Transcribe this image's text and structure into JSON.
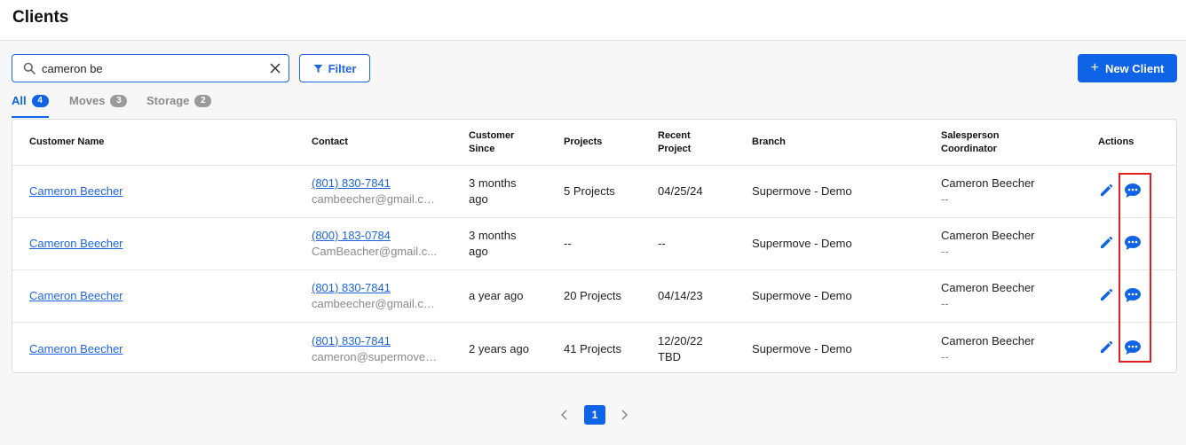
{
  "page": {
    "title": "Clients"
  },
  "search": {
    "value": "cameron be",
    "placeholder": ""
  },
  "toolbar": {
    "filter_label": "Filter",
    "new_client_label": "New Client"
  },
  "tabs": [
    {
      "label": "All",
      "count": "4",
      "active": true
    },
    {
      "label": "Moves",
      "count": "3",
      "active": false
    },
    {
      "label": "Storage",
      "count": "2",
      "active": false
    }
  ],
  "table": {
    "headers": {
      "customer_name": "Customer Name",
      "contact": "Contact",
      "customer_since_1": "Customer",
      "customer_since_2": "Since",
      "projects": "Projects",
      "recent_project_1": "Recent",
      "recent_project_2": "Project",
      "branch": "Branch",
      "salesperson": "Salesperson",
      "coordinator": "Coordinator",
      "actions": "Actions"
    },
    "rows": [
      {
        "name": "Cameron Beecher",
        "phone": "(801) 830-7841",
        "email": "cambeecher@gmail.com",
        "since_1": "3 months",
        "since_2": "ago",
        "projects": "5 Projects",
        "recent_1": "04/25/24",
        "recent_2": "",
        "branch": "Supermove - Demo",
        "salesperson": "Cameron Beecher",
        "coordinator": "--"
      },
      {
        "name": "Cameron Beecher",
        "phone": "(800) 183-0784",
        "email": "CamBeacher@gmail.c...",
        "since_1": "3 months",
        "since_2": "ago",
        "projects": "--",
        "recent_1": "--",
        "recent_2": "",
        "branch": "Supermove - Demo",
        "salesperson": "Cameron Beecher",
        "coordinator": "--"
      },
      {
        "name": "Cameron Beecher",
        "phone": "(801) 830-7841",
        "email": "cambeecher@gmail.com",
        "since_1": "a year ago",
        "since_2": "",
        "projects": "20 Projects",
        "recent_1": "04/14/23",
        "recent_2": "",
        "branch": "Supermove - Demo",
        "salesperson": "Cameron Beecher",
        "coordinator": "--"
      },
      {
        "name": "Cameron Beecher",
        "phone": "(801) 830-7841",
        "email": "cameron@supermove.co",
        "since_1": "2 years ago",
        "since_2": "",
        "projects": "41 Projects",
        "recent_1": "12/20/22",
        "recent_2": "TBD",
        "branch": "Supermove - Demo",
        "salesperson": "Cameron Beecher",
        "coordinator": "--"
      }
    ]
  },
  "pagination": {
    "current_page": "1"
  },
  "colors": {
    "accent": "#0f63e6",
    "highlight": "#e02020",
    "muted": "#8a8a8a"
  },
  "icons": [
    "search-icon",
    "clear-icon",
    "filter-icon",
    "plus-icon",
    "edit-icon",
    "message-icon",
    "chevron-left-icon",
    "chevron-right-icon"
  ]
}
